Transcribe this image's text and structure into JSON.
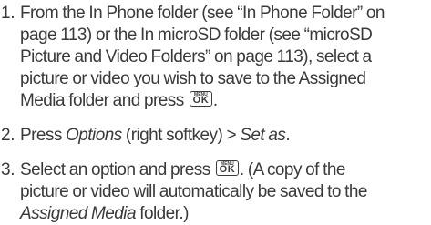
{
  "steps": [
    {
      "number": "1.",
      "lines": [
        "From the In Phone folder (see “In Phone Folder” on",
        "page 113) or the In microSD folder (see “microSD",
        "Picture and Video Folders” on page 113), select a",
        "picture or video you wish to save to the Assigned",
        "Media folder and press"
      ],
      "end": "."
    },
    {
      "number": "2.",
      "pre": "Press ",
      "options_em": "Options",
      "mid": " (right softkey) ",
      "arrow": ">",
      "setas_em": "Set as",
      "end": "."
    },
    {
      "number": "3.",
      "line1_pre": "Select an option and press",
      "line1_post": ". (A copy of the",
      "line2": "picture or video will automatically be saved to the",
      "folder_em": "Assigned Media",
      "line3_post": " folder.)"
    }
  ],
  "key": {
    "top_label": "MENU",
    "main_label": "OK"
  }
}
